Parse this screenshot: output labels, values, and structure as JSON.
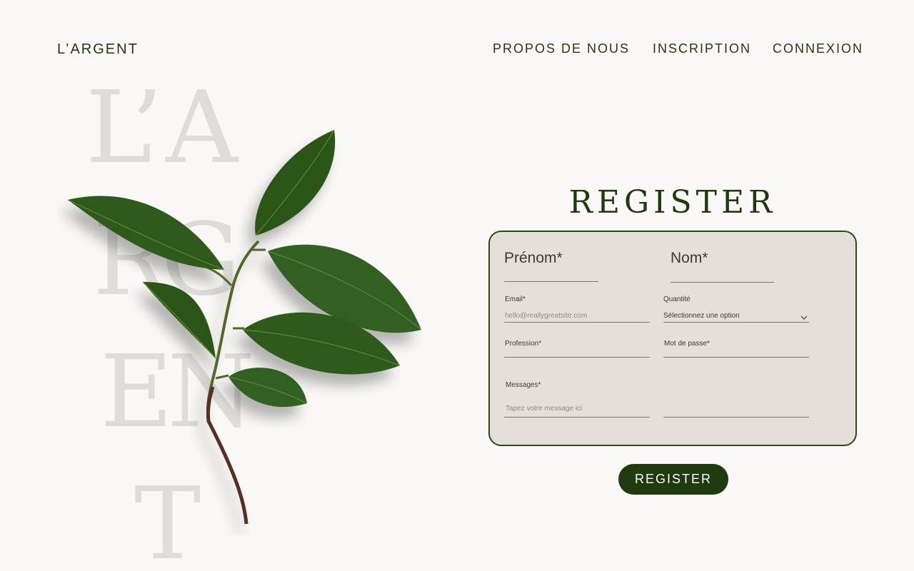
{
  "header": {
    "brand": "L’ARGENT",
    "nav": {
      "about": "PROPOS DE NOUS",
      "inscription": "INSCRIPTION",
      "connexion": "CONNEXION"
    }
  },
  "hero": {
    "bg_line_1": "L’A",
    "bg_line_2": "RG",
    "bg_line_3": "EN",
    "bg_line_4": "T",
    "image": "green-leaf-branch"
  },
  "form": {
    "title": "REGISTER",
    "first_name_label": "Prénom*",
    "last_name_label": "Nom*",
    "email_label": "Email*",
    "email_placeholder": "hello@reallygreatsite.com",
    "quantity_label": "Quantité",
    "quantity_value": "Sélectionnez une option",
    "profession_label": "Profession*",
    "password_label": "Mot de passe*",
    "messages_label": "Messages*",
    "messages_placeholder": "Tapez votre message ici",
    "submit_label": "REGISTER"
  },
  "colors": {
    "primary": "#1f3a0c",
    "background": "#f9f8f6",
    "card": "#e4dfd9"
  }
}
